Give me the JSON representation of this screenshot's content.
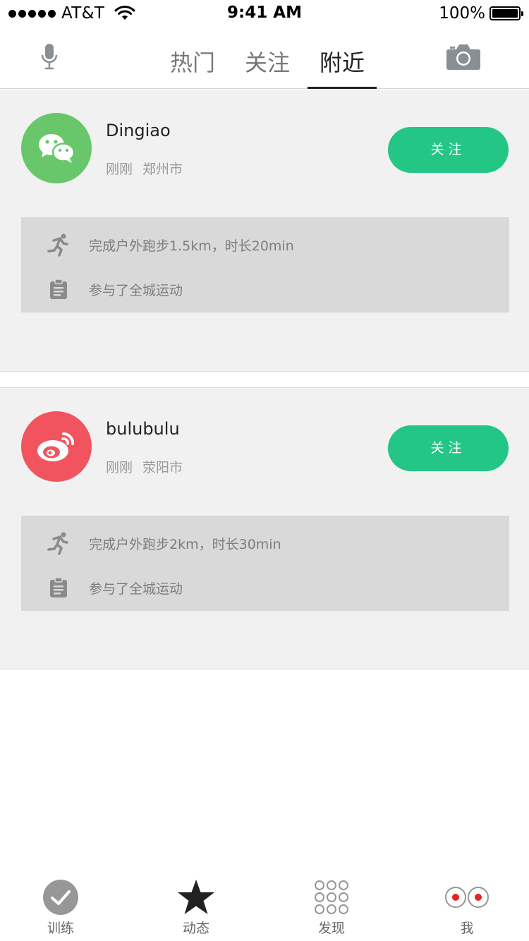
{
  "status_bar": {
    "carrier": "AT&T",
    "time": "9:41 AM",
    "battery": "100%",
    "battery_level": 1.0
  },
  "nav": {
    "mic_icon": "microphone-icon",
    "camera_icon": "camera-icon",
    "tabs": [
      {
        "label": "热门",
        "active": false
      },
      {
        "label": "关注",
        "active": false
      },
      {
        "label": "附近",
        "active": true
      }
    ]
  },
  "feed": [
    {
      "avatar_icon": "wechat-icon",
      "username": "Dingiao",
      "time": "刚刚",
      "location": "郑州市",
      "follow_label": "关注",
      "activities": [
        {
          "icon": "running-icon",
          "text": "完成户外跑步1.5km，时长20min"
        },
        {
          "icon": "clipboard-icon",
          "text": "参与了全城运动"
        }
      ]
    },
    {
      "avatar_icon": "weibo-icon",
      "username": "bulubulu",
      "time": "刚刚",
      "location": "荥阳市",
      "follow_label": "关注",
      "activities": [
        {
          "icon": "running-icon",
          "text": "完成户外跑步2km，时长30min"
        },
        {
          "icon": "clipboard-icon",
          "text": "参与了全城运动"
        }
      ]
    }
  ],
  "tabbar": [
    {
      "icon": "check-circle-icon",
      "label": "训练"
    },
    {
      "icon": "star-icon",
      "label": "动态"
    },
    {
      "icon": "grid-dots-icon",
      "label": "发现"
    },
    {
      "icon": "eyes-icon",
      "label": "我"
    }
  ],
  "colors": {
    "accent_green": "#23c684",
    "wechat_green": "#68c76a",
    "weibo_red": "#f2545f",
    "card_bg": "#f1f1f1",
    "activity_bg": "#d9d9d9"
  }
}
